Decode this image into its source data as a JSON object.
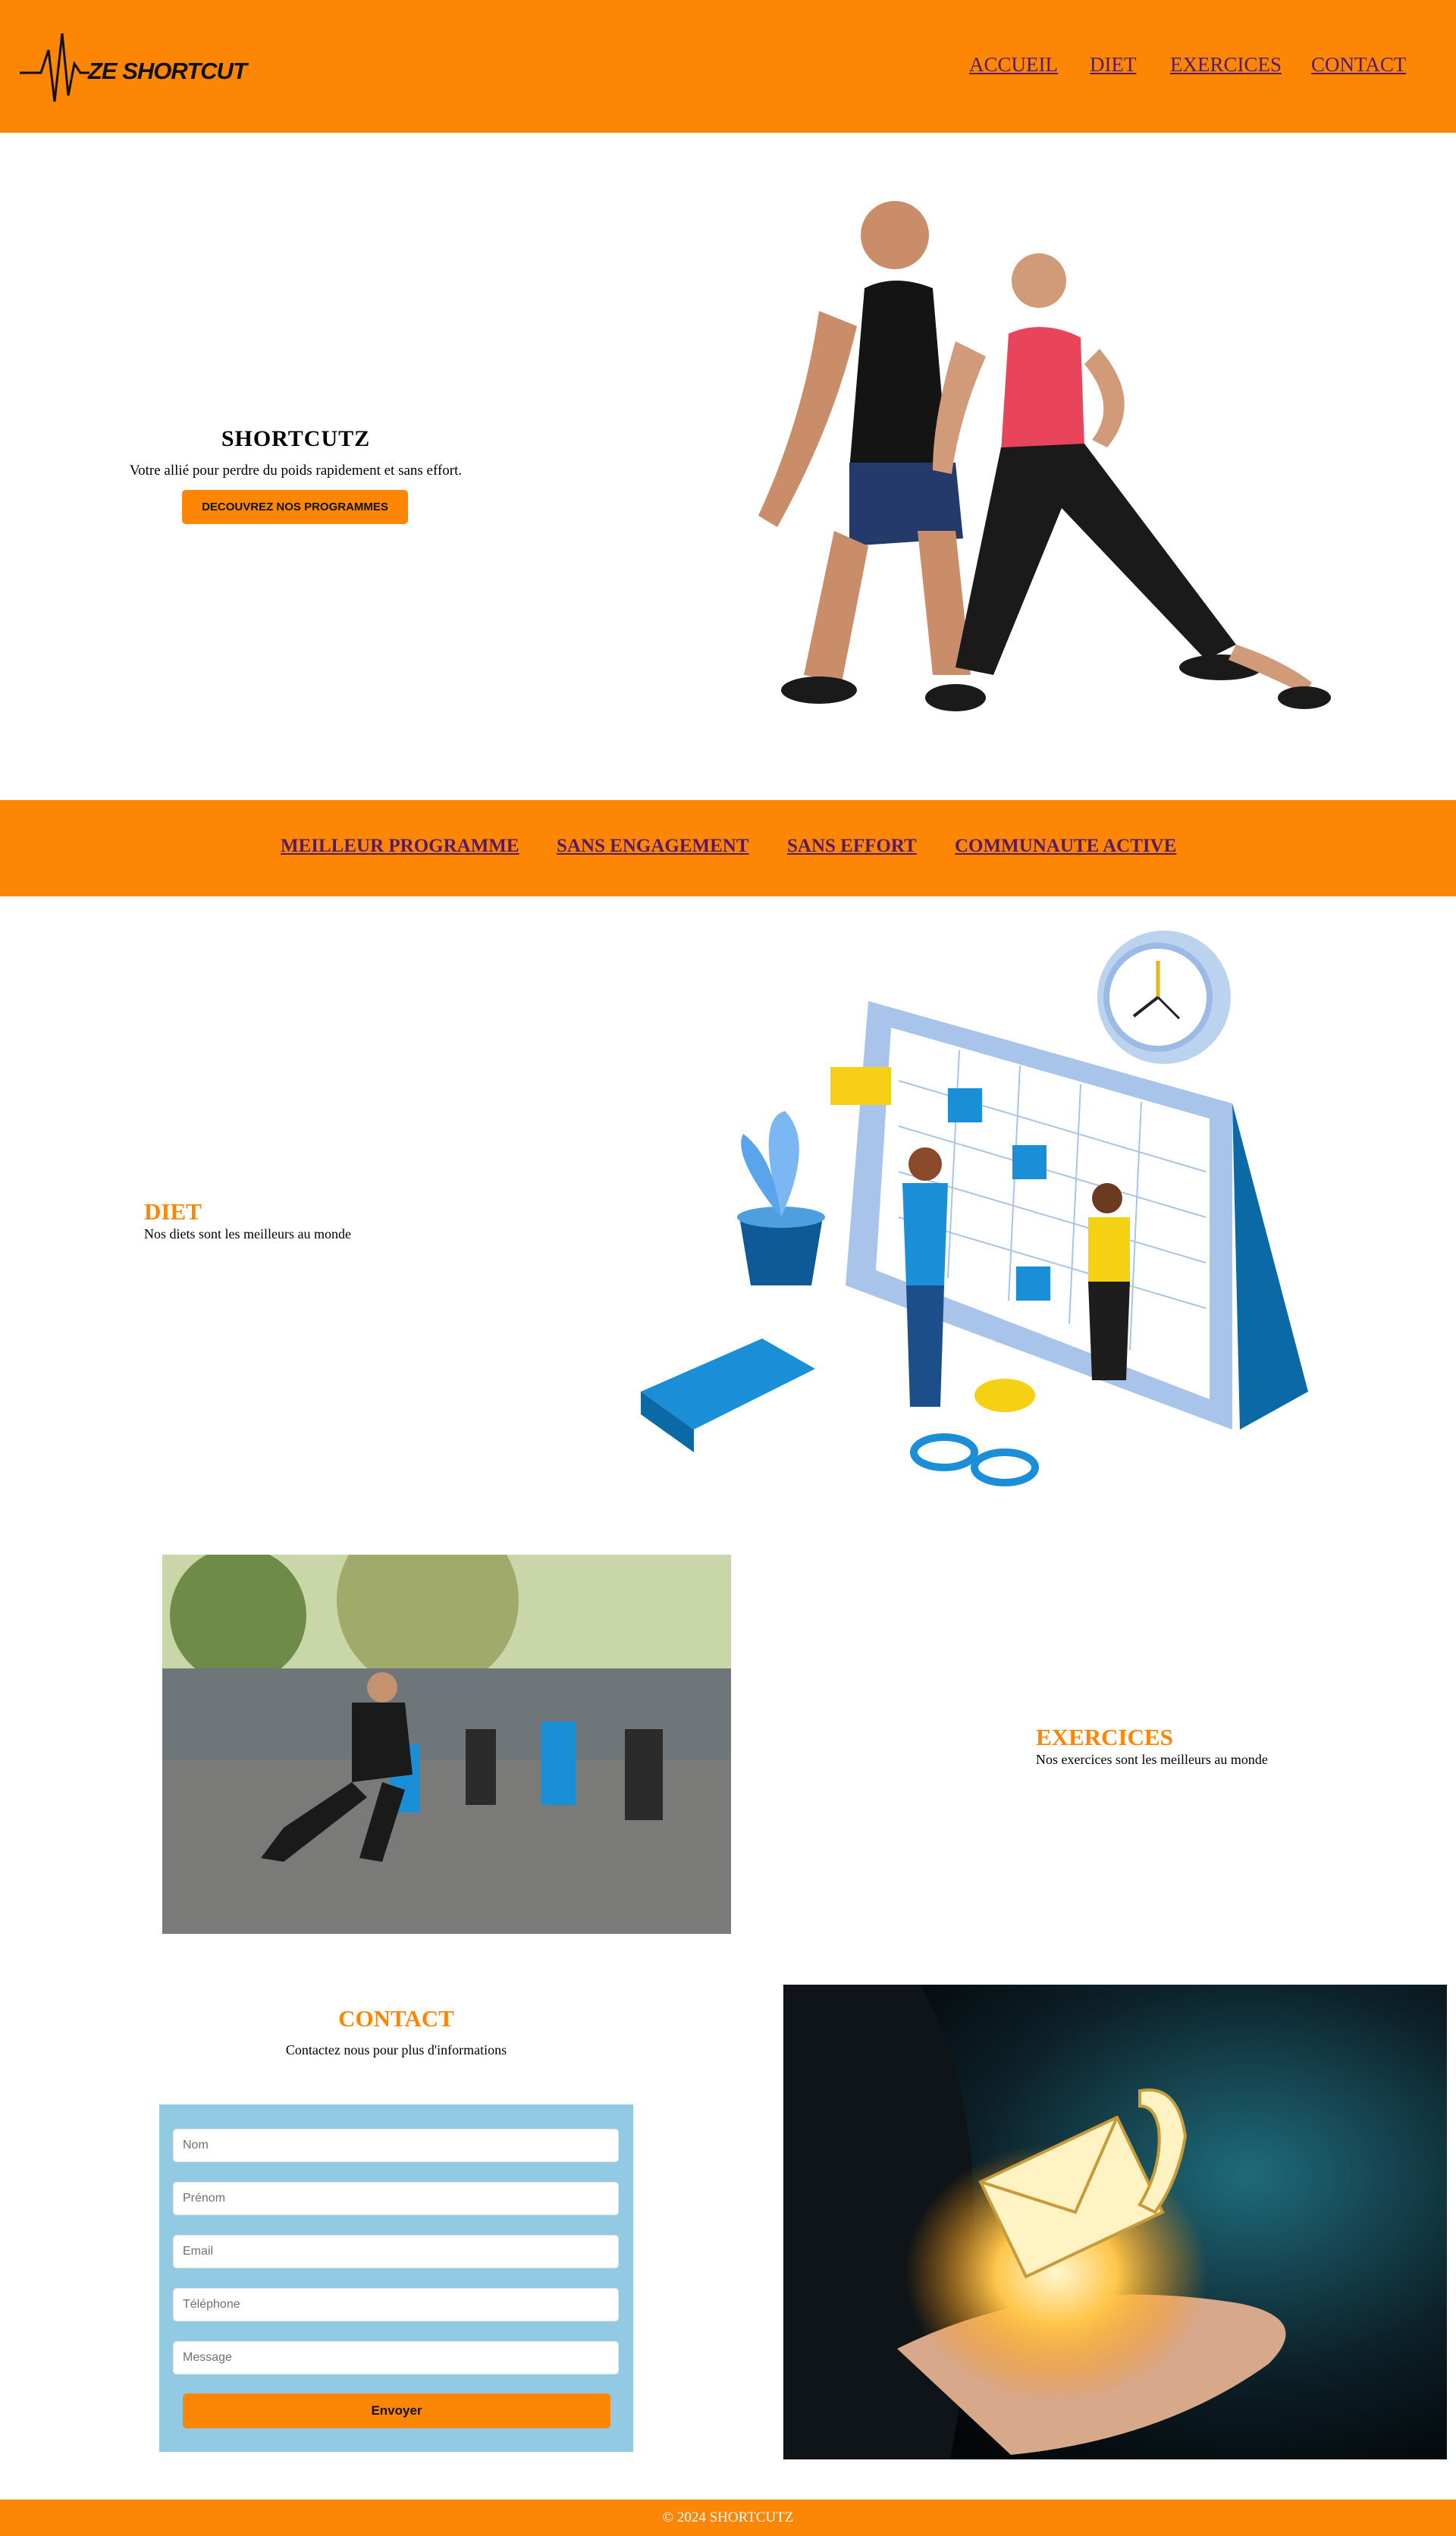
{
  "header": {
    "logo_text": "ZE SHORTCUT",
    "nav": [
      "ACCUEIL",
      "DIET",
      "EXERCICES",
      "CONTACT"
    ]
  },
  "hero": {
    "title": "SHORTCUTZ",
    "subtitle": "Votre allié pour perdre du poids rapidement et sans effort.",
    "button": "DECOUVREZ NOS PROGRAMMES"
  },
  "banner": {
    "links": [
      "MEILLEUR PROGRAMME",
      "SANS ENGAGEMENT",
      "SANS EFFORT",
      "COMMUNAUTE ACTIVE"
    ]
  },
  "diet": {
    "title": "DIET",
    "text": "Nos diets sont les meilleurs au monde"
  },
  "exercices": {
    "title": "EXERCICES",
    "text": "Nos exercices sont les meilleurs au monde"
  },
  "contact": {
    "title": "CONTACT",
    "subtitle": "Contactez nous pour plus d'informations",
    "placeholders": {
      "nom": "Nom",
      "prenom": "Prénom",
      "email": "Email",
      "telephone": "Téléphone",
      "message": "Message"
    },
    "submit": "Envoyer"
  },
  "footer": {
    "text": "© 2024 SHORTCUTZ"
  },
  "colors": {
    "accent": "#fd8605",
    "link": "#5a1a62",
    "form_bg": "#93cae3"
  }
}
